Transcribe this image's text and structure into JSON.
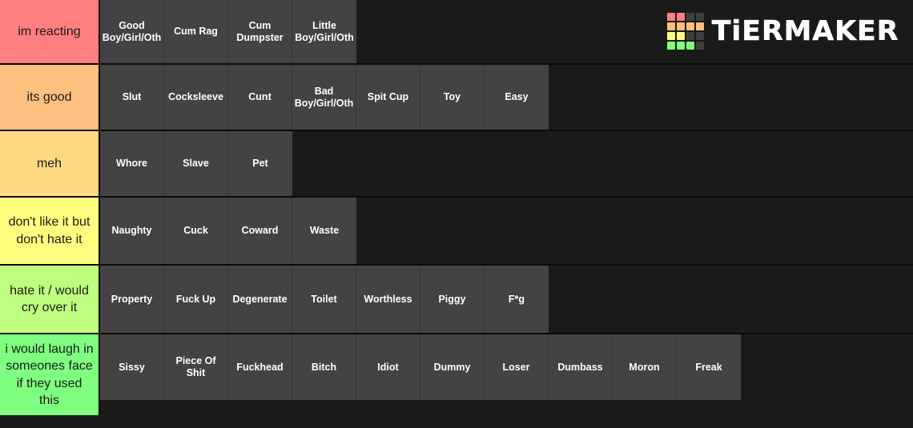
{
  "brand": {
    "name": "TiERMAKER",
    "logo_icon": "tiermaker-grid-logo",
    "grid_colors": [
      "#ff7f7f",
      "#ff7f7f",
      "#3f3f3f",
      "#3f3f3f",
      "#ffbe7f",
      "#ffbe7f",
      "#ffbe7f",
      "#ffbe7f",
      "#ffff7f",
      "#ffff7f",
      "#3f3f3f",
      "#3f3f3f",
      "#7fff7f",
      "#7fff7f",
      "#7fff7f",
      "#3f3f3f"
    ]
  },
  "colors": {
    "background": "#1a1a18",
    "item_fill": "#434343",
    "item_border": "#363636",
    "row_divider": "#0b0b0a",
    "label_text": "#1b1b1b",
    "item_text": "#ffffff"
  },
  "tiers": [
    {
      "label": "im reacting",
      "color": "#ff7f7f",
      "items": [
        "Good Boy/Girl/Oth",
        "Cum Rag",
        "Cum Dumpster",
        "Little Boy/Girl/Oth"
      ]
    },
    {
      "label": "its good",
      "color": "#ffbf7f",
      "items": [
        "Slut",
        "Cocksleeve",
        "Cunt",
        "Bad Boy/Girl/Oth",
        "Spit Cup",
        "Toy",
        "Easy"
      ]
    },
    {
      "label": "meh",
      "color": "#ffd97f",
      "items": [
        "Whore",
        "Slave",
        "Pet"
      ]
    },
    {
      "label": "don't like it but don't hate it",
      "color": "#ffff7f",
      "items": [
        "Naughty",
        "Cuck",
        "Coward",
        "Waste"
      ]
    },
    {
      "label": "hate it / would cry over it",
      "color": "#bfff7f",
      "items": [
        "Property",
        "Fuck Up",
        "Degenerate",
        "Toilet",
        "Worthless",
        "Piggy",
        "F*g"
      ]
    },
    {
      "label": "i would laugh in someones face if they used this",
      "color": "#7fff7f",
      "items": [
        "Sissy",
        "Piece Of Shit",
        "Fuckhead",
        "Bitch",
        "Idiot",
        "Dummy",
        "Loser",
        "Dumbass",
        "Moron",
        "Freak"
      ]
    }
  ]
}
